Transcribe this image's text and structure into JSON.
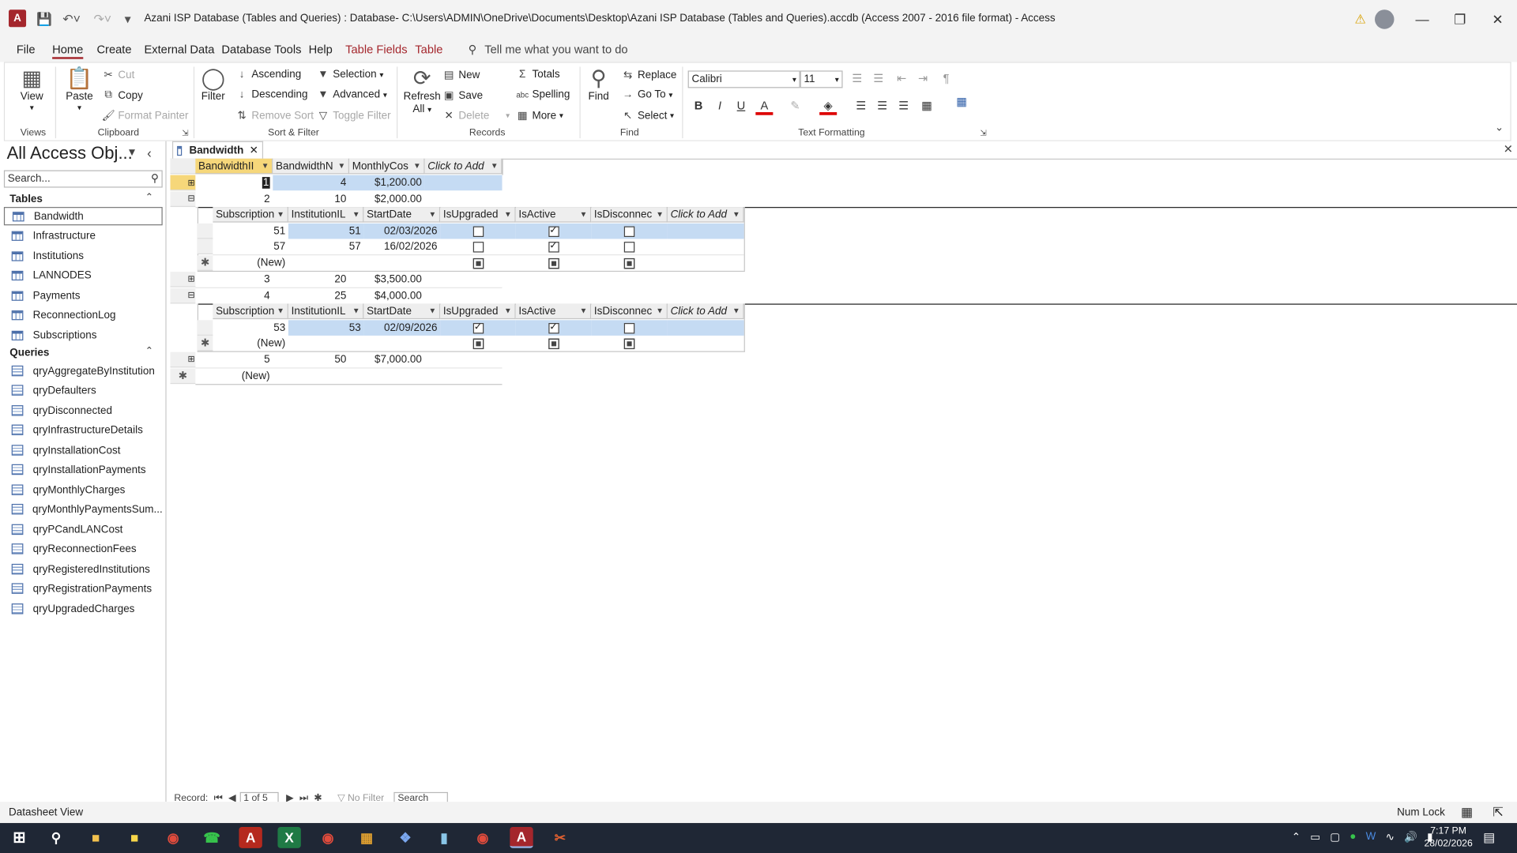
{
  "window": {
    "title": "Azani ISP Database (Tables and Queries) : Database- C:\\Users\\ADMIN\\OneDrive\\Documents\\Desktop\\Azani ISP Database (Tables and Queries).accdb (Access 2007 - 2016 file format)  -  Access",
    "app_logo": "A"
  },
  "menu": {
    "tabs": [
      "File",
      "Home",
      "Create",
      "External Data",
      "Database Tools",
      "Help",
      "Table Fields",
      "Table"
    ],
    "active": "Home",
    "tell_me": "Tell me what you want to do"
  },
  "ribbon": {
    "views": {
      "view_label": "View",
      "group": "Views"
    },
    "clipboard": {
      "paste": "Paste",
      "cut": "Cut",
      "copy": "Copy",
      "format_painter": "Format Painter",
      "group": "Clipboard"
    },
    "sort_filter": {
      "filter": "Filter",
      "ascending": "Ascending",
      "descending": "Descending",
      "remove_sort": "Remove Sort",
      "selection": "Selection",
      "advanced": "Advanced",
      "toggle_filter": "Toggle Filter",
      "group": "Sort & Filter"
    },
    "records": {
      "refresh": "Refresh",
      "refresh_sub": "All",
      "new": "New",
      "save": "Save",
      "delete": "Delete",
      "totals": "Totals",
      "spelling": "Spelling",
      "more": "More",
      "group": "Records"
    },
    "find": {
      "find": "Find",
      "replace": "Replace",
      "goto": "Go To",
      "select": "Select",
      "group": "Find"
    },
    "text_formatting": {
      "font": "Calibri",
      "size": "11",
      "bold": "B",
      "italic": "I",
      "underline": "U",
      "group": "Text Formatting"
    }
  },
  "nav": {
    "title": "All Access Obj...",
    "search_placeholder": "Search...",
    "tables_label": "Tables",
    "queries_label": "Queries",
    "tables": [
      "Bandwidth",
      "Infrastructure",
      "Institutions",
      "LANNODES",
      "Payments",
      "ReconnectionLog",
      "Subscriptions"
    ],
    "queries": [
      "qryAggregateByInstitution",
      "qryDefaulters",
      "qryDisconnected",
      "qryInfrastructureDetails",
      "qryInstallationCost",
      "qryInstallationPayments",
      "qryMonthlyCharges",
      "qryMonthlyPaymentsSum...",
      "qryPCandLANCost",
      "qryReconnectionFees",
      "qryRegisteredInstitutions",
      "qryRegistrationPayments",
      "qryUpgradedCharges"
    ]
  },
  "doc": {
    "tab_label": "Bandwidth",
    "main_headers": [
      "BandwidthII",
      "BandwidthN",
      "MonthlyCos",
      "Click to Add"
    ],
    "sub_headers": [
      "Subscription",
      "InstitutionIL",
      "StartDate",
      "IsUpgraded",
      "IsActive",
      "IsDisconnec",
      "Click to Add"
    ],
    "rows": [
      {
        "id": "1",
        "mbps": "4",
        "cost": "$1,200.00"
      },
      {
        "id": "2",
        "mbps": "10",
        "cost": "$2,000.00"
      },
      {
        "id": "3",
        "mbps": "20",
        "cost": "$3,500.00"
      },
      {
        "id": "4",
        "mbps": "25",
        "cost": "$4,000.00"
      },
      {
        "id": "5",
        "mbps": "50",
        "cost": "$7,000.00"
      }
    ],
    "sub_rows_2": [
      {
        "sub": "51",
        "inst": "51",
        "date": "02/03/2026",
        "up": false,
        "act": true,
        "dis": false
      },
      {
        "sub": "57",
        "inst": "57",
        "date": "16/02/2026",
        "up": false,
        "act": true,
        "dis": false
      }
    ],
    "sub_rows_4": [
      {
        "sub": "53",
        "inst": "53",
        "date": "02/09/2026",
        "up": true,
        "act": true,
        "dis": false
      }
    ],
    "new_label": "(New)"
  },
  "recnav": {
    "label": "Record:",
    "position": "1 of 5",
    "filter": "No Filter",
    "search": "Search"
  },
  "status": {
    "left": "Datasheet View",
    "num_lock": "Num Lock"
  },
  "taskbar": {
    "time": "7:17 PM",
    "date": "28/02/2026"
  },
  "colors": {
    "accent": "#a4262c",
    "highlight": "#c5dbf3",
    "header_selected": "#f6d77a"
  }
}
